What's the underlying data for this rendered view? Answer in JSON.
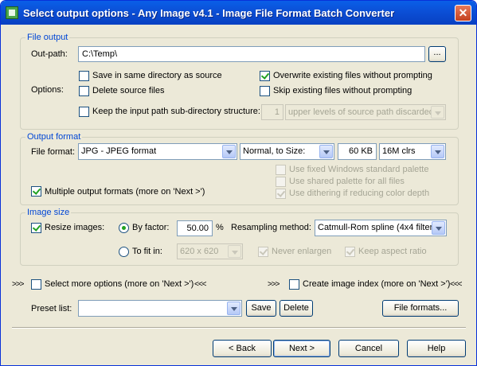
{
  "window": {
    "title": "Select output options - Any Image v4.1 - Image File Format Batch Converter"
  },
  "file_output": {
    "legend": "File output",
    "out_path_label": "Out-path:",
    "out_path_value": "C:\\Temp\\",
    "browse_label": "...",
    "options_label": "Options:",
    "save_same_dir": {
      "label": "Save in same directory as source",
      "checked": false
    },
    "overwrite": {
      "label": "Overwrite existing files without prompting",
      "checked": true
    },
    "delete_source": {
      "label": "Delete source files",
      "checked": false
    },
    "skip_existing": {
      "label": "Skip existing files without prompting",
      "checked": false
    },
    "keep_structure": {
      "label": "Keep the input path sub-directory structure:",
      "checked": false
    },
    "levels_value": "1",
    "levels_select": "upper levels of source path discarded"
  },
  "output_format": {
    "legend": "Output format",
    "file_format_label": "File format:",
    "file_format_value": "JPG - JPEG format",
    "quality_mode": "Normal, to Size:",
    "size_value": "60 KB",
    "colors_value": "16M clrs",
    "fixed_palette": {
      "label": "Use fixed Windows standard palette",
      "checked": false
    },
    "shared_palette": {
      "label": "Use shared palette for all files",
      "checked": false
    },
    "dithering": {
      "label": "Use dithering if reducing color depth",
      "checked": true
    },
    "multiple_formats": {
      "label": "Multiple output formats (more on 'Next >')",
      "checked": true
    }
  },
  "image_size": {
    "legend": "Image size",
    "resize": {
      "label": "Resize images:",
      "checked": true
    },
    "by_factor": {
      "label": "By factor:",
      "selected": true
    },
    "factor_value": "50.00",
    "factor_unit": "%",
    "resampling_label": "Resampling method:",
    "resampling_value": "Catmull-Rom spline (4x4 filter)",
    "to_fit": {
      "label": "To fit in:",
      "selected": false
    },
    "fit_value": "620 x 620",
    "never_enlarge": {
      "label": "Never enlargen",
      "checked": true
    },
    "keep_aspect": {
      "label": "Keep aspect ratio",
      "checked": true
    }
  },
  "extras": {
    "arrows_left": ">>>",
    "arrows_right": "<<<",
    "more_options": {
      "label": "Select more options (more on 'Next >')",
      "checked": false
    },
    "create_index": {
      "label": "Create image index (more on 'Next >')",
      "checked": false
    }
  },
  "preset": {
    "label": "Preset list:",
    "value": "",
    "save_label": "Save",
    "delete_label": "Delete",
    "file_formats_label": "File formats..."
  },
  "nav": {
    "back_label": "< Back",
    "next_label": "Next >",
    "cancel_label": "Cancel",
    "help_label": "Help"
  }
}
